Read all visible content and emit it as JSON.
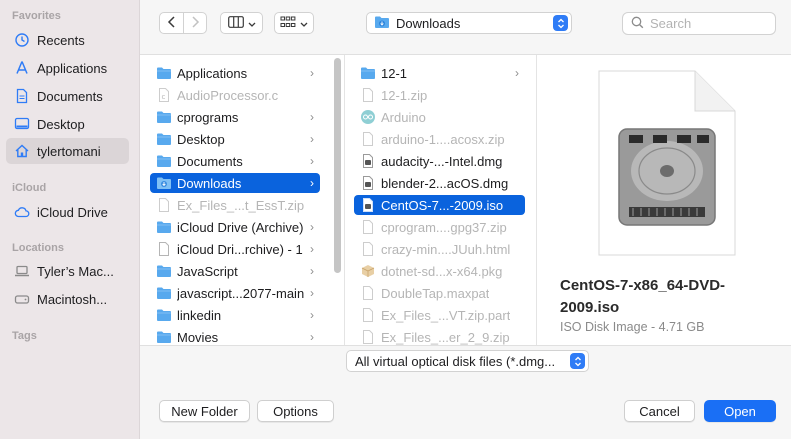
{
  "sidebar": {
    "sections": [
      {
        "heading": "Favorites"
      },
      {
        "heading": "iCloud"
      },
      {
        "heading": "Locations"
      },
      {
        "heading": "Tags"
      }
    ],
    "items": [
      {
        "label": "Recents",
        "icon": "clock-icon"
      },
      {
        "label": "Applications",
        "icon": "applications-icon"
      },
      {
        "label": "Documents",
        "icon": "document-icon"
      },
      {
        "label": "Desktop",
        "icon": "desktop-icon"
      },
      {
        "label": "tylertomani",
        "icon": "home-icon",
        "selected": true
      },
      {
        "label": "iCloud Drive",
        "icon": "cloud-icon"
      },
      {
        "label": "Tyler’s Mac...",
        "icon": "laptop-icon"
      },
      {
        "label": "Macintosh...",
        "icon": "disk-icon"
      }
    ]
  },
  "toolbar": {
    "path_label": "Downloads",
    "search_placeholder": "Search"
  },
  "column1": [
    {
      "name": "Applications",
      "kind": "folder",
      "chevron": true
    },
    {
      "name": "AudioProcessor.c",
      "kind": "file-c",
      "dim": true
    },
    {
      "name": "cprograms",
      "kind": "folder",
      "chevron": true
    },
    {
      "name": "Desktop",
      "kind": "folder",
      "chevron": true
    },
    {
      "name": "Documents",
      "kind": "folder",
      "chevron": true
    },
    {
      "name": "Downloads",
      "kind": "folder-downloads",
      "chevron": true,
      "selected": true
    },
    {
      "name": "Ex_Files_...t_EssT.zip",
      "kind": "file",
      "dim": true
    },
    {
      "name": "iCloud Drive (Archive)",
      "kind": "folder",
      "chevron": true
    },
    {
      "name": "iCloud Dri...rchive) - 1",
      "kind": "file",
      "chevron": true
    },
    {
      "name": "JavaScript",
      "kind": "folder",
      "chevron": true
    },
    {
      "name": "javascript...2077-main",
      "kind": "folder",
      "chevron": true
    },
    {
      "name": "linkedin",
      "kind": "folder",
      "chevron": true
    },
    {
      "name": "Movies",
      "kind": "folder",
      "chevron": true
    }
  ],
  "column2": [
    {
      "name": "12-1",
      "kind": "folder",
      "chevron": true
    },
    {
      "name": "12-1.zip",
      "kind": "file",
      "dim": true
    },
    {
      "name": "Arduino",
      "kind": "app-arduino",
      "dim": true
    },
    {
      "name": "arduino-1....acosx.zip",
      "kind": "file",
      "dim": true
    },
    {
      "name": "audacity-...-Intel.dmg",
      "kind": "dmg"
    },
    {
      "name": "blender-2...acOS.dmg",
      "kind": "dmg"
    },
    {
      "name": "CentOS-7...-2009.iso",
      "kind": "iso",
      "selected": true
    },
    {
      "name": "cprogram....gpg37.zip",
      "kind": "file",
      "dim": true
    },
    {
      "name": "crazy-min....JUuh.html",
      "kind": "file",
      "dim": true
    },
    {
      "name": "dotnet-sd...x-x64.pkg",
      "kind": "pkg",
      "dim": true
    },
    {
      "name": "DoubleTap.maxpat",
      "kind": "file",
      "dim": true
    },
    {
      "name": "Ex_Files_...VT.zip.part",
      "kind": "file",
      "dim": true
    },
    {
      "name": "Ex_Files_...er_2_9.zip",
      "kind": "file",
      "dim": true
    }
  ],
  "preview": {
    "title": "CentOS-7-x86_64-DVD-2009.iso",
    "meta": "ISO Disk Image - 4.71 GB"
  },
  "format_popup": "All virtual optical disk files (*.dmg...",
  "buttons": {
    "new_folder": "New Folder",
    "options": "Options",
    "cancel": "Cancel",
    "open": "Open"
  },
  "colors": {
    "accent": "#0a63dd",
    "primary_button": "#1a6ff5",
    "sidebar_bg": "#ece6e8"
  }
}
